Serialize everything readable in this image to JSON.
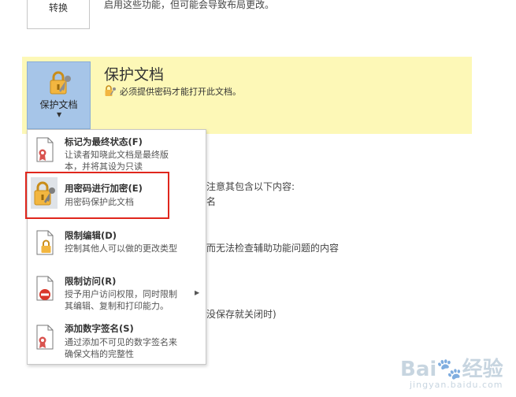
{
  "convert": {
    "label": "转换",
    "description": "启用这些功能，但可能会导致布局更改。"
  },
  "protect": {
    "button_label": "保护文档",
    "title": "保护文档",
    "description": "必须提供密码才能打开此文档。",
    "icon": "lock-key-icon",
    "band_color": "#fdf8b7"
  },
  "background_text": {
    "line1": "注意其包含以下内容:",
    "line2": "名",
    "line3": "而无法检查辅助功能问题的内容",
    "line4": "没保存就关闭时)"
  },
  "menu": {
    "items": [
      {
        "title": "标记为最终状态(F)",
        "desc_line1": "让读者知晓此文档是最终版",
        "desc_line2": "本，并将其设为只读",
        "icon": "ribbon-document-icon"
      },
      {
        "title": "用密码进行加密(E)",
        "desc_line1": "用密码保护此文档",
        "desc_line2": "",
        "icon": "lock-key-icon"
      },
      {
        "title": "限制编辑(D)",
        "desc_line1": "控制其他人可以做的更改类型",
        "desc_line2": "",
        "icon": "lock-document-icon"
      },
      {
        "title": "限制访问(R)",
        "desc_line1": "授予用户访问权限，同时限制",
        "desc_line2": "其编辑、复制和打印能力。",
        "icon": "restricted-document-icon"
      },
      {
        "title": "添加数字签名(S)",
        "desc_line1": "通过添加不可见的数字签名来",
        "desc_line2": "确保文档的完整性",
        "icon": "ribbon-document-icon"
      }
    ]
  },
  "highlight_color": "#e0271d",
  "watermark": {
    "logo": "Bai🐾经验",
    "url": "jingyan.baidu.com"
  }
}
